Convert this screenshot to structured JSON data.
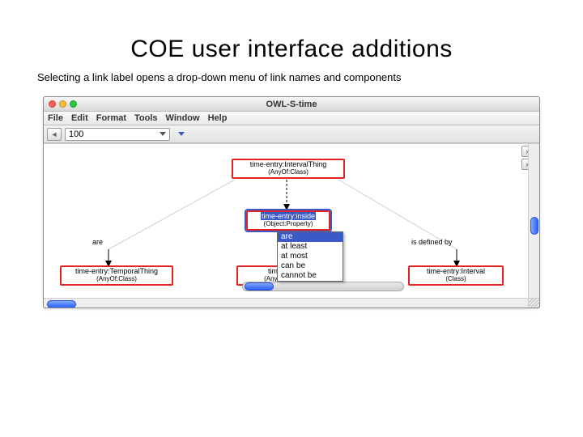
{
  "slide": {
    "title": "COE user interface additions",
    "subtitle": "Selecting a link label opens a drop-down menu of link names and components"
  },
  "window": {
    "title": "OWL-S-time",
    "menu": {
      "file": "File",
      "edit": "Edit",
      "format": "Format",
      "tools": "Tools",
      "window": "Window",
      "help": "Help"
    }
  },
  "toolbar": {
    "zoom_value": "100"
  },
  "side_tools": {
    "t1": "xT",
    "t2": "xC"
  },
  "canvas": {
    "top_node": {
      "l1": "time-entry:IntervalThing",
      "l2": "(AnyOf:Class)"
    },
    "mid_node": {
      "l1": "time-entry:inside",
      "l2": "(Object:Property)"
    },
    "left_node": {
      "l1": "time-entry:TemporalThing",
      "l2": "(AnyOf:Class)"
    },
    "mid_bottom": {
      "l1": "time-entry",
      "l2": "(AnyOf:Class)"
    },
    "right_node": {
      "l1": "time-entry:Interval",
      "l2": "(Class)"
    },
    "label_left": "are",
    "label_right": "is defined by",
    "dropdown": {
      "i0": "are",
      "i1": "at least",
      "i2": "at most",
      "i3": "can be",
      "i4": "cannot be"
    }
  }
}
